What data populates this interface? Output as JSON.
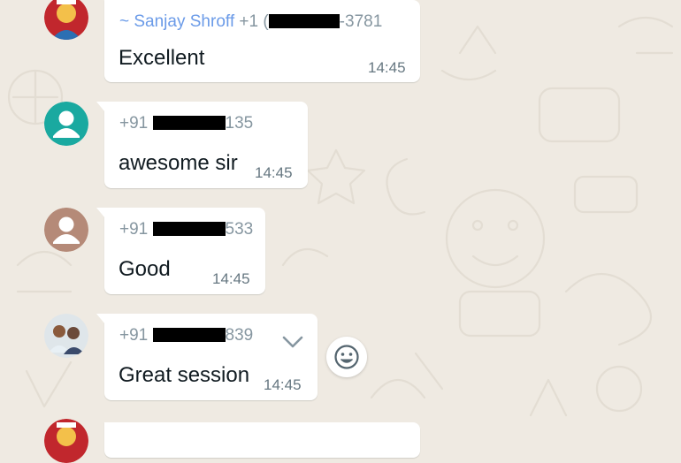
{
  "messages": [
    {
      "sender_name": "~ Sanjay Shroff",
      "sender_phone_prefix": "+1 (",
      "sender_phone_suffix": "-3781",
      "text": "Excellent",
      "time": "14:45",
      "avatar": "photo-red"
    },
    {
      "sender_name": "",
      "sender_phone_prefix": "+91 ",
      "sender_phone_suffix": "135",
      "text": "awesome sir",
      "time": "14:45",
      "avatar": "default-teal"
    },
    {
      "sender_name": "",
      "sender_phone_prefix": "+91 ",
      "sender_phone_suffix": "533",
      "text": "Good",
      "time": "14:45",
      "avatar": "default-brown"
    },
    {
      "sender_name": "",
      "sender_phone_prefix": "+91 ",
      "sender_phone_suffix": "839",
      "text": "Great session",
      "time": "14:45",
      "avatar": "photo-couple"
    }
  ],
  "colors": {
    "background": "#efeae2",
    "bubble": "#ffffff",
    "sender_name": "#6b9be8",
    "teal_avatar": "#1aa9a0",
    "brown_avatar": "#b58a78"
  },
  "icons": {
    "message_menu": "chevron-down-icon",
    "react": "smiley-icon"
  }
}
